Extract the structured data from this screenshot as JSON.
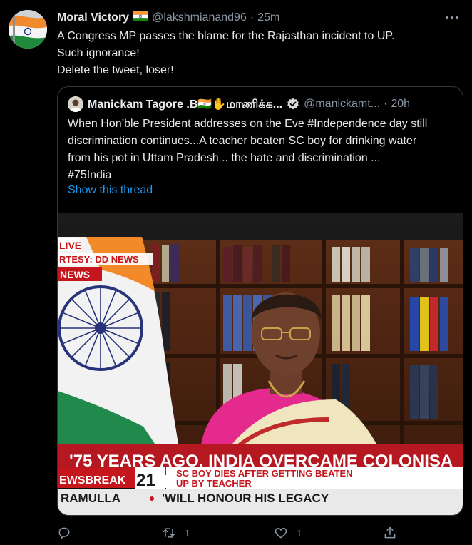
{
  "tweet": {
    "display_name": "Moral Victory",
    "flag_icon": "india-flag-icon",
    "handle": "@lakshmianand96",
    "separator": "·",
    "time": "25m",
    "lines": [
      "A Congress MP passes the blame for the Rajasthan incident to UP.",
      "Such ignorance!",
      "Delete the tweet, loser!"
    ]
  },
  "quoted": {
    "display_name": "Manickam Tagore .B🇮🇳✋மாணிக்க...",
    "handle": "@manickamt...",
    "separator": "·",
    "time": "20h",
    "lines": [
      "When Hon’ble President addresses on the Eve #Independence day still",
      "discrimination continues...A teacher beaten SC boy for drinking water",
      "from his pot in Uttam Pradesh .. the hate and discrimination ...",
      "#75India"
    ],
    "show_thread": "Show this thread",
    "media": {
      "tag_live": "LIVE",
      "tag_courtesy": "RTESY: DD NEWS",
      "tag_news": "NEWS",
      "ticker_main": "'75 YEARS AGO, INDIA OVERCAME COLONISA",
      "ticker_label": "EWSBREAK",
      "ticker_number": "21",
      "ticker_headline_1": "SC BOY DIES AFTER GETTING BEATEN",
      "ticker_headline_2": "UP BY TEACHER",
      "ticker_bottom_left": "RAMULLA",
      "ticker_bottom_right": "'WILL HONOUR HIS LEGACY"
    }
  },
  "actions": {
    "reply_count": "",
    "retweet_count": "1",
    "like_count": "1",
    "share_count": ""
  },
  "colors": {
    "background": "#000000",
    "text": "#e7e9ea",
    "muted": "#8b98a5",
    "link": "#1d9bf0",
    "border": "#333639",
    "news_red": "#c4161c"
  }
}
